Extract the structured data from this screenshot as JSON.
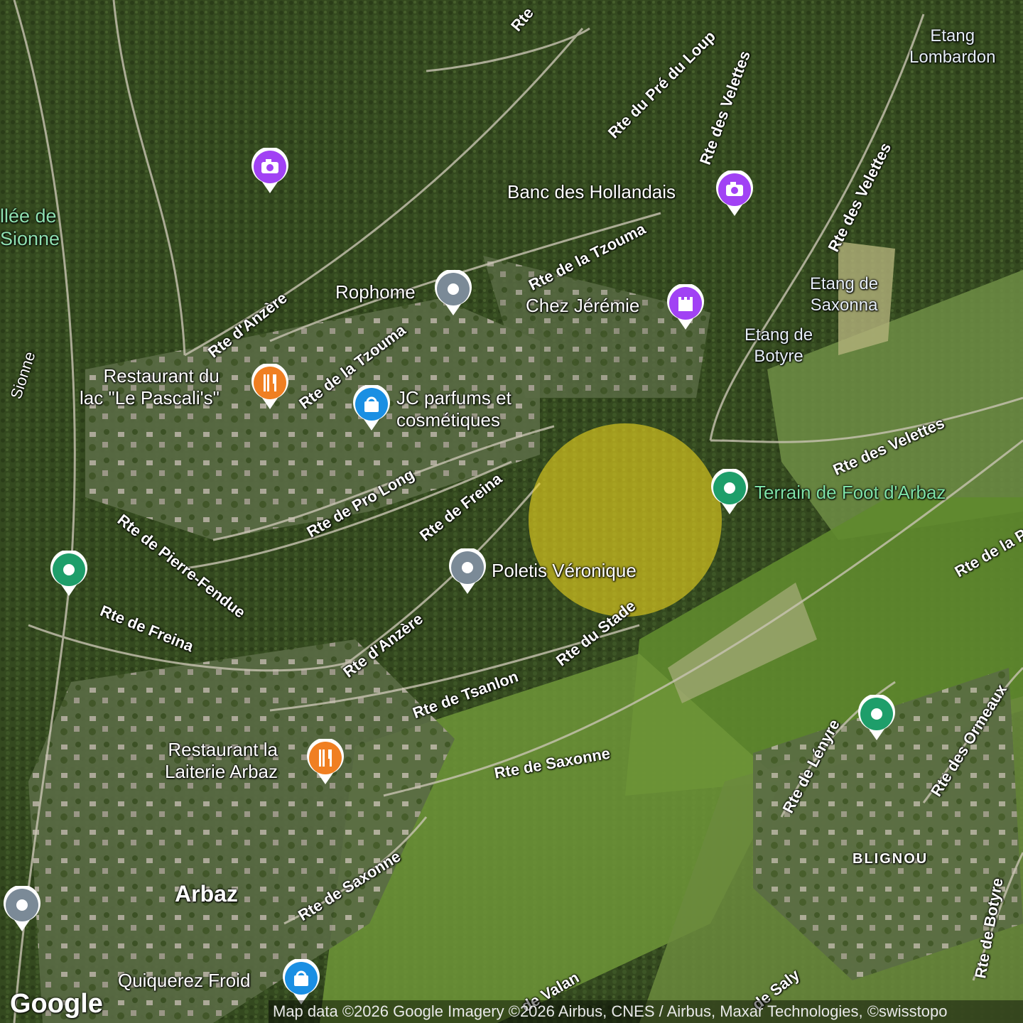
{
  "map": {
    "places": {
      "vallee": "llée de\nSionne",
      "sionne": "Sionne",
      "etang_lombardon": "Etang\nLombardon",
      "etang_saxonna": "Etang de\nSaxonna",
      "etang_botyre": "Etang de\nBotyre",
      "arbaz": "Arbaz",
      "blignou": "BLIGNOU"
    },
    "roads": {
      "rte_top": "Rte",
      "pre_du_loup": "Rte du Pré du Loup",
      "velettes_1": "Rte des Velettes",
      "velettes_2": "Rte des Velettes",
      "velettes_3": "Rte des Velettes",
      "tzouma_1": "Rte de la Tzouma",
      "tzouma_2": "Rte de la Tzouma",
      "anzere_1": "Rte d'Anzère",
      "anzere_2": "Rte d'Anzère",
      "pro_long": "Rte de Pro Long",
      "freina_1": "Rte de Freina",
      "freina_2": "Rte de Freina",
      "pierre_fendue": "Rte de Pierre-Fendue",
      "stade": "Rte du Stade",
      "tsanlon": "Rte de Tsanlon",
      "saxonne_1": "Rte de Saxonne",
      "saxonne_2": "Rte de Saxonne",
      "lenyre": "Rte de Lényre",
      "ormeaux": "Rte des Ormeaux",
      "botyre": "Rte de Botyre",
      "rte_de_la": "Rte de la P",
      "valan": "de Valan",
      "saly": "de Saly"
    },
    "pois": {
      "banc_hollandais": "Banc des Hollandais",
      "rophome": "Rophome",
      "chez_jeremie": "Chez Jérémie",
      "restaurant_pascali": "Restaurant du\nlac \"Le Pascali's\"",
      "jc_parfums": "JC parfums et\ncosmétiques",
      "terrain_foot": "Terrain de Foot d'Arbaz",
      "poletis": "Poletis Véronique",
      "restaurant_laiterie": "Restaurant la\nLaiterie Arbaz",
      "quiquerez": "Quiquerez Froid"
    },
    "attribution": "Map data ©2026 Google Imagery ©2026 Airbus, CNES / Airbus, Maxar Technologies, ©swisstopo",
    "logo": "Google",
    "colors": {
      "camera": "#a142f4",
      "generic": "#7b8a97",
      "green": "#1e9e6a",
      "food": "#f07f22",
      "shop": "#1a8fe3",
      "landmark": "#a142f4"
    },
    "icons": [
      "camera-icon",
      "dot-icon",
      "fork-knife-icon",
      "shopping-bag-icon",
      "castle-icon"
    ]
  }
}
